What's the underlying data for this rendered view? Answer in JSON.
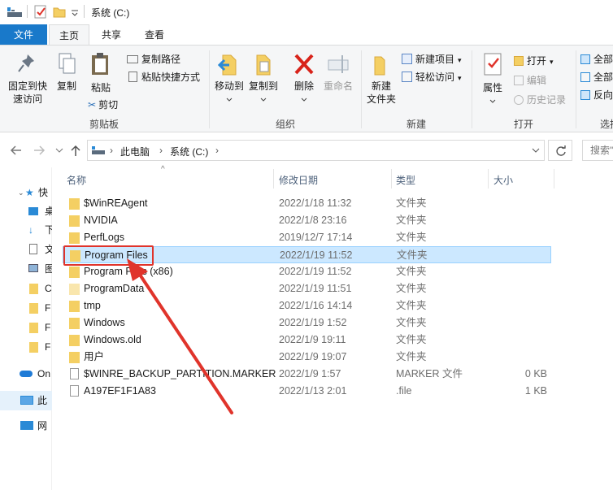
{
  "titlebar": {
    "title": "系统 (C:)"
  },
  "ribbon_tabs": {
    "file": "文件",
    "home": "主页",
    "share": "共享",
    "view": "查看"
  },
  "ribbon": {
    "pin": "固定到快速访问",
    "pin_l1": "固定到快",
    "pin_l2": "速访问",
    "copy": "复制",
    "paste": "粘贴",
    "copy_path": "复制路径",
    "paste_shortcut": "粘贴快捷方式",
    "cut": "剪切",
    "group_clipboard": "剪贴板",
    "move_to": "移动到",
    "copy_to": "复制到",
    "delete": "删除",
    "rename": "重命名",
    "group_organize": "组织",
    "new_folder_l1": "新建",
    "new_folder_l2": "文件夹",
    "new_item": "新建项目",
    "easy_access": "轻松访问",
    "group_new": "新建",
    "properties": "属性",
    "open": "打开",
    "edit": "编辑",
    "history": "历史记录",
    "group_open": "打开",
    "select_all": "全部",
    "select_none": "全部",
    "invert": "反向",
    "group_select": "选择"
  },
  "address": {
    "pc": "此电脑",
    "drive": "系统 (C:)",
    "search_placeholder": "搜索\""
  },
  "navpane": [
    "快",
    "桌",
    "下",
    "文",
    "图",
    "C",
    "F",
    "F",
    "F",
    "On",
    "此",
    "网"
  ],
  "columns": {
    "name": "名称",
    "date": "修改日期",
    "type": "类型",
    "size": "大小"
  },
  "files": [
    {
      "name": "$WinREAgent",
      "date": "2022/1/18 11:32",
      "type": "文件夹",
      "size": "",
      "kind": "folder"
    },
    {
      "name": "NVIDIA",
      "date": "2022/1/8 23:16",
      "type": "文件夹",
      "size": "",
      "kind": "folder"
    },
    {
      "name": "PerfLogs",
      "date": "2019/12/7 17:14",
      "type": "文件夹",
      "size": "",
      "kind": "folder"
    },
    {
      "name": "Program Files",
      "date": "2022/1/19 11:52",
      "type": "文件夹",
      "size": "",
      "kind": "folder",
      "selected": true
    },
    {
      "name": "Program Files (x86)",
      "date": "2022/1/19 11:52",
      "type": "文件夹",
      "size": "",
      "kind": "folder"
    },
    {
      "name": "ProgramData",
      "date": "2022/1/19 11:51",
      "type": "文件夹",
      "size": "",
      "kind": "folder-faded"
    },
    {
      "name": "tmp",
      "date": "2022/1/16 14:14",
      "type": "文件夹",
      "size": "",
      "kind": "folder"
    },
    {
      "name": "Windows",
      "date": "2022/1/19 1:52",
      "type": "文件夹",
      "size": "",
      "kind": "folder"
    },
    {
      "name": "Windows.old",
      "date": "2022/1/9 19:11",
      "type": "文件夹",
      "size": "",
      "kind": "folder"
    },
    {
      "name": "用户",
      "date": "2022/1/9 19:07",
      "type": "文件夹",
      "size": "",
      "kind": "folder"
    },
    {
      "name": "$WINRE_BACKUP_PARTITION.MARKER",
      "date": "2022/1/9 1:57",
      "type": "MARKER 文件",
      "size": "0 KB",
      "kind": "file"
    },
    {
      "name": "A197EF1F1A83",
      "date": "2022/1/13 2:01",
      "type": ".file",
      "size": "1 KB",
      "kind": "file"
    }
  ],
  "colors": {
    "accent": "#1979ca",
    "selection": "#cce8ff",
    "annotation": "#e0342b",
    "folder": "#f4cf63"
  }
}
